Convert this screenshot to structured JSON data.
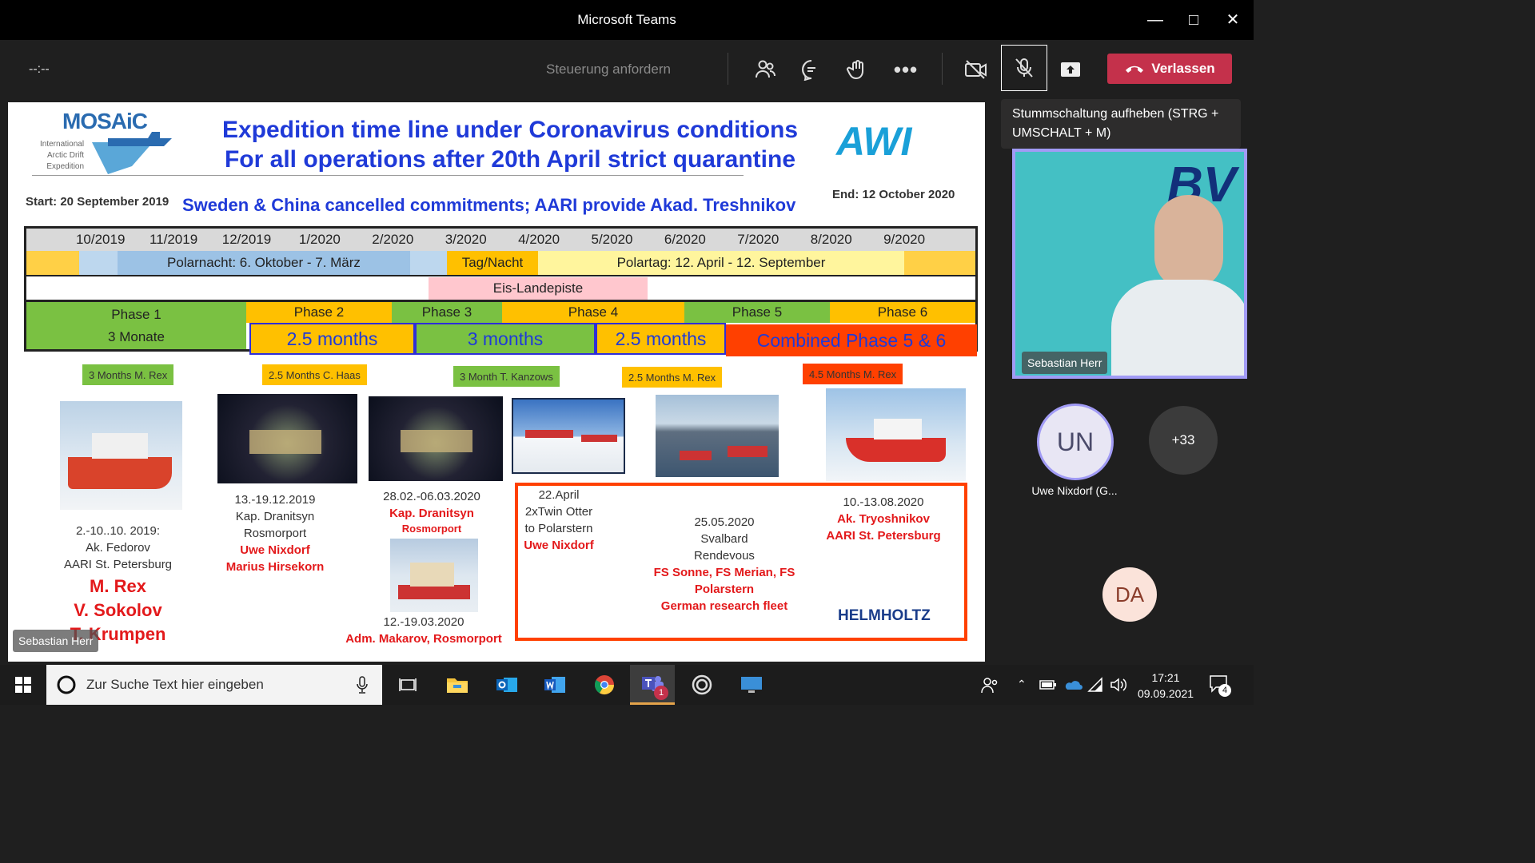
{
  "window": {
    "title": "Microsoft Teams"
  },
  "toolbar": {
    "timer": "--:--",
    "request_control": "Steuerung anfordern",
    "leave_label": "Verlassen",
    "tooltip": "Stummschaltung aufheben (STRG + UMSCHALT + M)"
  },
  "slide": {
    "logo_text": "MOSAiC",
    "logo_sub": [
      "International",
      "Arctic Drift",
      "Expedition"
    ],
    "awi": "AWI",
    "title_line1": "Expedition time line under Coronavirus conditions",
    "title_line2": "For all operations after 20th April strict quarantine",
    "start": "Start: 20 September 2019",
    "subtitle": "Sweden & China cancelled commitments; AARI provide Akad. Treshnikov",
    "end": "End: 12 October 2020",
    "months": [
      "10/2019",
      "11/2019",
      "12/2019",
      "1/2020",
      "2/2020",
      "3/2020",
      "4/2020",
      "5/2020",
      "6/2020",
      "7/2020",
      "8/2020",
      "9/2020"
    ],
    "polarnacht": "Polarnacht: 6. Oktober - 7. März",
    "tagnacht": "Tag/Nacht",
    "polartag": "Polartag: 12. April - 12. September",
    "eis": "Eis-Landepiste",
    "phases": [
      "Phase 1",
      "Phase 2",
      "Phase 3",
      "Phase 4",
      "Phase 5",
      "Phase 6"
    ],
    "phase1_duration": "3 Monate",
    "durations": [
      "2.5 months",
      "3 months",
      "2.5 months",
      "Combined Phase 5 & 6"
    ],
    "leg_labels": [
      "3 Months M. Rex",
      "2.5 Months C. Haas",
      "3 Month T. Kanzows",
      "2.5 Months M. Rex",
      "4.5 Months M. Rex"
    ],
    "cap1": [
      "2.-10..10. 2019:",
      "Ak. Fedorov",
      "AARI St. Petersburg"
    ],
    "cap1_red": [
      "M. Rex",
      "V. Sokolov",
      "T. Krumpen"
    ],
    "cap2": [
      "13.-19.12.2019",
      "Kap. Dranitsyn",
      "Rosmorport"
    ],
    "cap2_red": [
      "Uwe Nixdorf",
      "Marius Hirsekorn"
    ],
    "cap3": "28.02.-06.03.2020",
    "cap3_red": "Kap. Dranitsyn",
    "cap3_red_small": "Rosmorport",
    "cap3b": "12.-19.03.2020",
    "cap3b_red": "Adm. Makarov, Rosmorport",
    "cap4": [
      "22.April",
      "2xTwin Otter",
      "to Polarstern"
    ],
    "cap4_red": "Uwe Nixdorf",
    "cap5": [
      "25.05.2020",
      "Svalbard",
      "Rendevous"
    ],
    "cap5_red": [
      "FS Sonne, FS Merian, FS",
      "Polarstern",
      "German research fleet"
    ],
    "cap6": "10.-13.08.2020",
    "cap6_red": [
      "Ak. Tryoshnikov",
      "AARI St. Petersburg"
    ],
    "helmholtz": "HELMHOLTZ",
    "presenter_tag": "Sebastian Herr"
  },
  "participants": {
    "video_name": "Sebastian Herr",
    "video_banner": "BV",
    "un_initials": "UN",
    "un_name": "Uwe Nixdorf (G...",
    "more": "+33",
    "da_initials": "DA"
  },
  "taskbar": {
    "search_placeholder": "Zur Suche Text hier eingeben",
    "time": "17:21",
    "date": "09.09.2021",
    "teams_badge": "1",
    "notif_count": "4"
  },
  "colors": {
    "accent": "#c4314b",
    "presenter_border": "#a19bf5",
    "slide_blue": "#1f3ad8"
  }
}
